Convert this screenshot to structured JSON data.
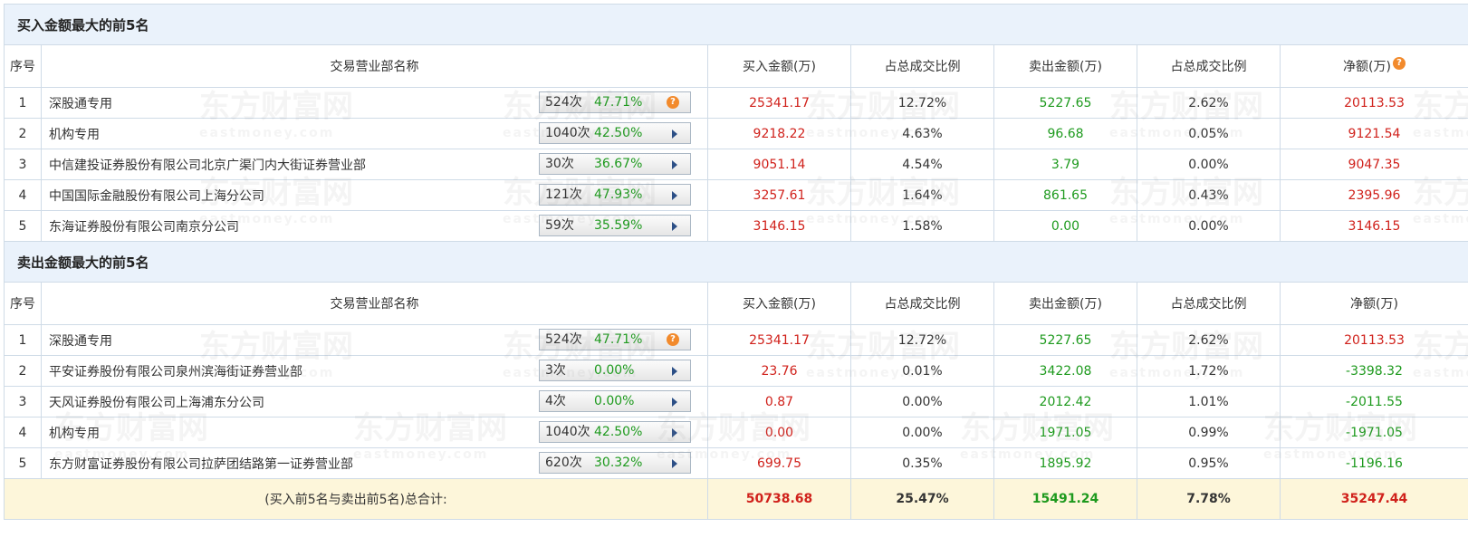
{
  "buy_section": {
    "title": "买入金额最大的前5名",
    "headers": [
      "序号",
      "交易营业部名称",
      "买入金额(万)",
      "占总成交比例",
      "卖出金额(万)",
      "占总成交比例",
      "净额(万)"
    ],
    "rows": [
      {
        "idx": "1",
        "name": "深股通专用",
        "count": "524次",
        "pct": "47.71%",
        "badge": "question",
        "buy": "25341.17",
        "buy_ratio": "12.72%",
        "sell": "5227.65",
        "sell_ratio": "2.62%",
        "net": "20113.53"
      },
      {
        "idx": "2",
        "name": "机构专用",
        "count": "1040次",
        "pct": "42.50%",
        "badge": "arrow",
        "buy": "9218.22",
        "buy_ratio": "4.63%",
        "sell": "96.68",
        "sell_ratio": "0.05%",
        "net": "9121.54"
      },
      {
        "idx": "3",
        "name": "中信建投证券股份有限公司北京广渠门内大街证券营业部",
        "count": "30次",
        "pct": "36.67%",
        "badge": "arrow",
        "buy": "9051.14",
        "buy_ratio": "4.54%",
        "sell": "3.79",
        "sell_ratio": "0.00%",
        "net": "9047.35"
      },
      {
        "idx": "4",
        "name": "中国国际金融股份有限公司上海分公司",
        "count": "121次",
        "pct": "47.93%",
        "badge": "arrow",
        "buy": "3257.61",
        "buy_ratio": "1.64%",
        "sell": "861.65",
        "sell_ratio": "0.43%",
        "net": "2395.96"
      },
      {
        "idx": "5",
        "name": "东海证券股份有限公司南京分公司",
        "count": "59次",
        "pct": "35.59%",
        "badge": "arrow",
        "buy": "3146.15",
        "buy_ratio": "1.58%",
        "sell": "0.00",
        "sell_ratio": "0.00%",
        "net": "3146.15"
      }
    ]
  },
  "sell_section": {
    "title": "卖出金额最大的前5名",
    "headers": [
      "序号",
      "交易营业部名称",
      "买入金额(万)",
      "占总成交比例",
      "卖出金额(万)",
      "占总成交比例",
      "净额(万)"
    ],
    "rows": [
      {
        "idx": "1",
        "name": "深股通专用",
        "count": "524次",
        "pct": "47.71%",
        "badge": "question",
        "buy": "25341.17",
        "buy_ratio": "12.72%",
        "sell": "5227.65",
        "sell_ratio": "2.62%",
        "net": "20113.53"
      },
      {
        "idx": "2",
        "name": "平安证券股份有限公司泉州滨海街证券营业部",
        "count": "3次",
        "pct": "0.00%",
        "badge": "arrow",
        "buy": "23.76",
        "buy_ratio": "0.01%",
        "sell": "3422.08",
        "sell_ratio": "1.72%",
        "net": "-3398.32"
      },
      {
        "idx": "3",
        "name": "天风证券股份有限公司上海浦东分公司",
        "count": "4次",
        "pct": "0.00%",
        "badge": "arrow",
        "buy": "0.87",
        "buy_ratio": "0.00%",
        "sell": "2012.42",
        "sell_ratio": "1.01%",
        "net": "-2011.55"
      },
      {
        "idx": "4",
        "name": "机构专用",
        "count": "1040次",
        "pct": "42.50%",
        "badge": "arrow",
        "buy": "0.00",
        "buy_ratio": "0.00%",
        "sell": "1971.05",
        "sell_ratio": "0.99%",
        "net": "-1971.05"
      },
      {
        "idx": "5",
        "name": "东方财富证券股份有限公司拉萨团结路第一证券营业部",
        "count": "620次",
        "pct": "30.32%",
        "badge": "arrow",
        "buy": "699.75",
        "buy_ratio": "0.35%",
        "sell": "1895.92",
        "sell_ratio": "0.95%",
        "net": "-1196.16"
      }
    ]
  },
  "total": {
    "label": "(买入前5名与卖出前5名)总合计:",
    "buy": "50738.68",
    "buy_ratio": "25.47%",
    "sell": "15491.24",
    "sell_ratio": "7.78%",
    "net": "35247.44"
  },
  "watermark": {
    "cn": "东方财富网",
    "en": "eastmoney.com"
  },
  "colors": {
    "positive": "#d0211b",
    "negative": "#1e9a1e",
    "header_bg": "#eaf2fb",
    "total_bg": "#fdf6da",
    "badge_orange": "#f28a2c"
  }
}
